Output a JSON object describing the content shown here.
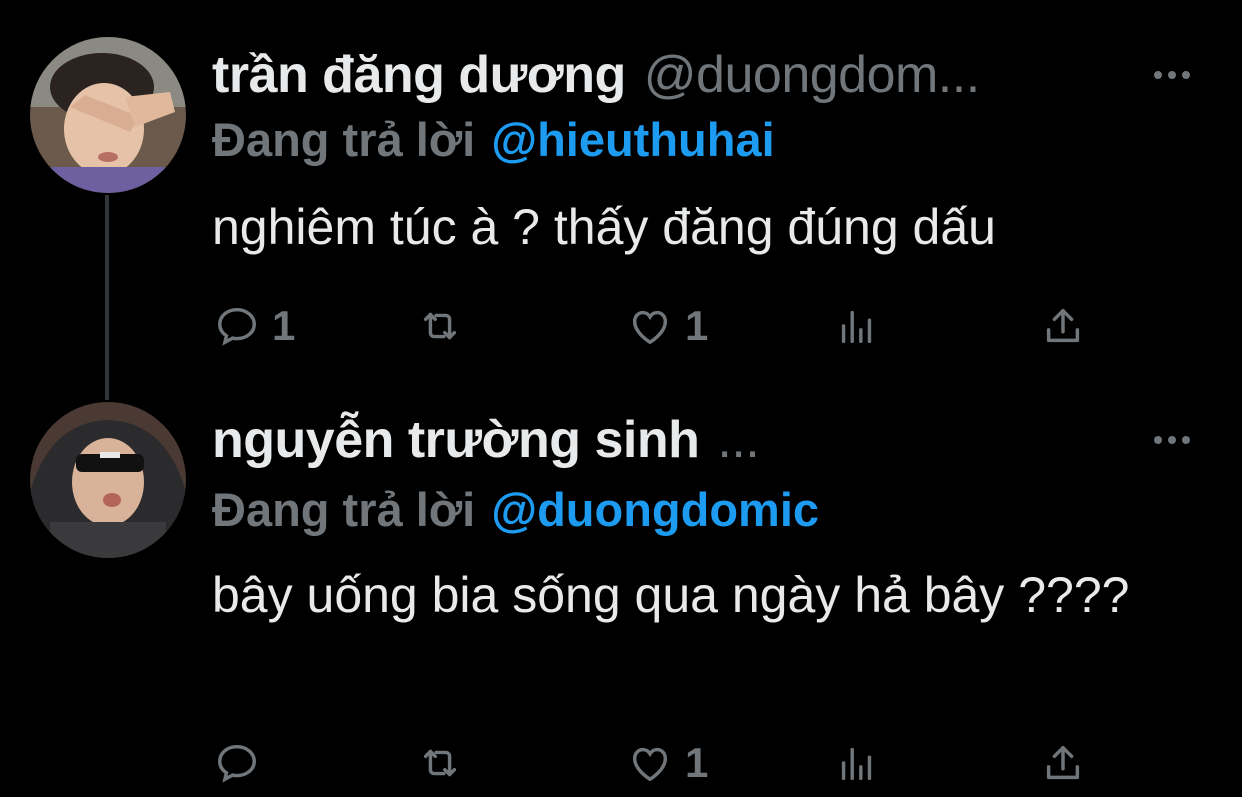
{
  "tweets": [
    {
      "display_name": "trần đăng dương",
      "handle": "@duongdom...",
      "reply_prefix": "Đang trả lời",
      "reply_to": "@hieuthuhai",
      "text": "nghiêm túc à ? thấy đăng đúng dấu",
      "actions": {
        "reply_count": "1",
        "retweet_count": "",
        "like_count": "1"
      }
    },
    {
      "display_name": "nguyễn trường sinh",
      "handle": "...",
      "reply_prefix": "Đang trả lời",
      "reply_to": "@duongdomic",
      "text": "bây uống bia sống qua ngày hả bây ????",
      "actions": {
        "reply_count": "",
        "retweet_count": "",
        "like_count": "1"
      }
    }
  ],
  "icons": {
    "reply": "reply-icon",
    "retweet": "retweet-icon",
    "like": "heart-icon",
    "views": "views-icon",
    "share": "share-icon",
    "more": "more-icon"
  },
  "colors": {
    "background": "#000000",
    "text": "#e7e9ea",
    "muted": "#71767b",
    "link": "#1d9bf0"
  }
}
